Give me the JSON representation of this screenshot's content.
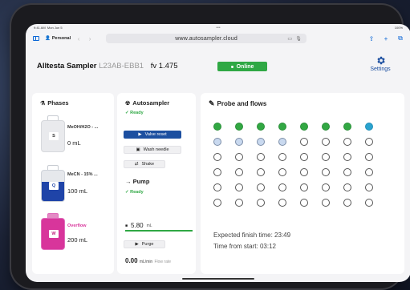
{
  "browser": {
    "time": "9:41 AM",
    "date": "Mon Jun 5",
    "status_right": "100%",
    "profile": "Personal",
    "url": "www.autosampler.cloud"
  },
  "header": {
    "app_name": "Alltesta Sampler",
    "serial": "L23AB-EBB1",
    "firmware": "fv 1.475",
    "status": "Online",
    "settings_label": "Settings"
  },
  "phases": {
    "title": "Phases",
    "bottles": [
      {
        "tag": "S",
        "name": "MeOH/H2O - ...",
        "volume": "0 mL"
      },
      {
        "tag": "Q",
        "name": "MeCN - 15% ...",
        "volume": "100 mL"
      },
      {
        "tag": "W",
        "name": "Overflow",
        "volume": "200 mL"
      }
    ]
  },
  "autosampler": {
    "title": "Autosampler",
    "status": "Ready",
    "buttons": {
      "valve_reset": "Valve reset",
      "wash_needle": "Wash needle",
      "shake": "Shake"
    },
    "pump": {
      "title": "Pump",
      "status": "Ready",
      "volume": "5.80",
      "volume_unit": "mL",
      "purge": "Purge",
      "flow_value": "0.00",
      "flow_unit": "mL/min",
      "flow_label": "Flow rate"
    }
  },
  "probe": {
    "title": "Probe and flows",
    "rows": 6,
    "cols": 8,
    "completed": 7,
    "active_index": 7,
    "queued": 4,
    "expected_finish_label": "Expected finish time:",
    "expected_finish": "23:49",
    "time_from_start_label": "Time from start:",
    "time_from_start": "03:12"
  },
  "colors": {
    "accent": "#1c4fa0",
    "online": "#2fa844",
    "completed": "#32a843",
    "active": "#2aa3cf",
    "queued": "#c9d9ef"
  }
}
